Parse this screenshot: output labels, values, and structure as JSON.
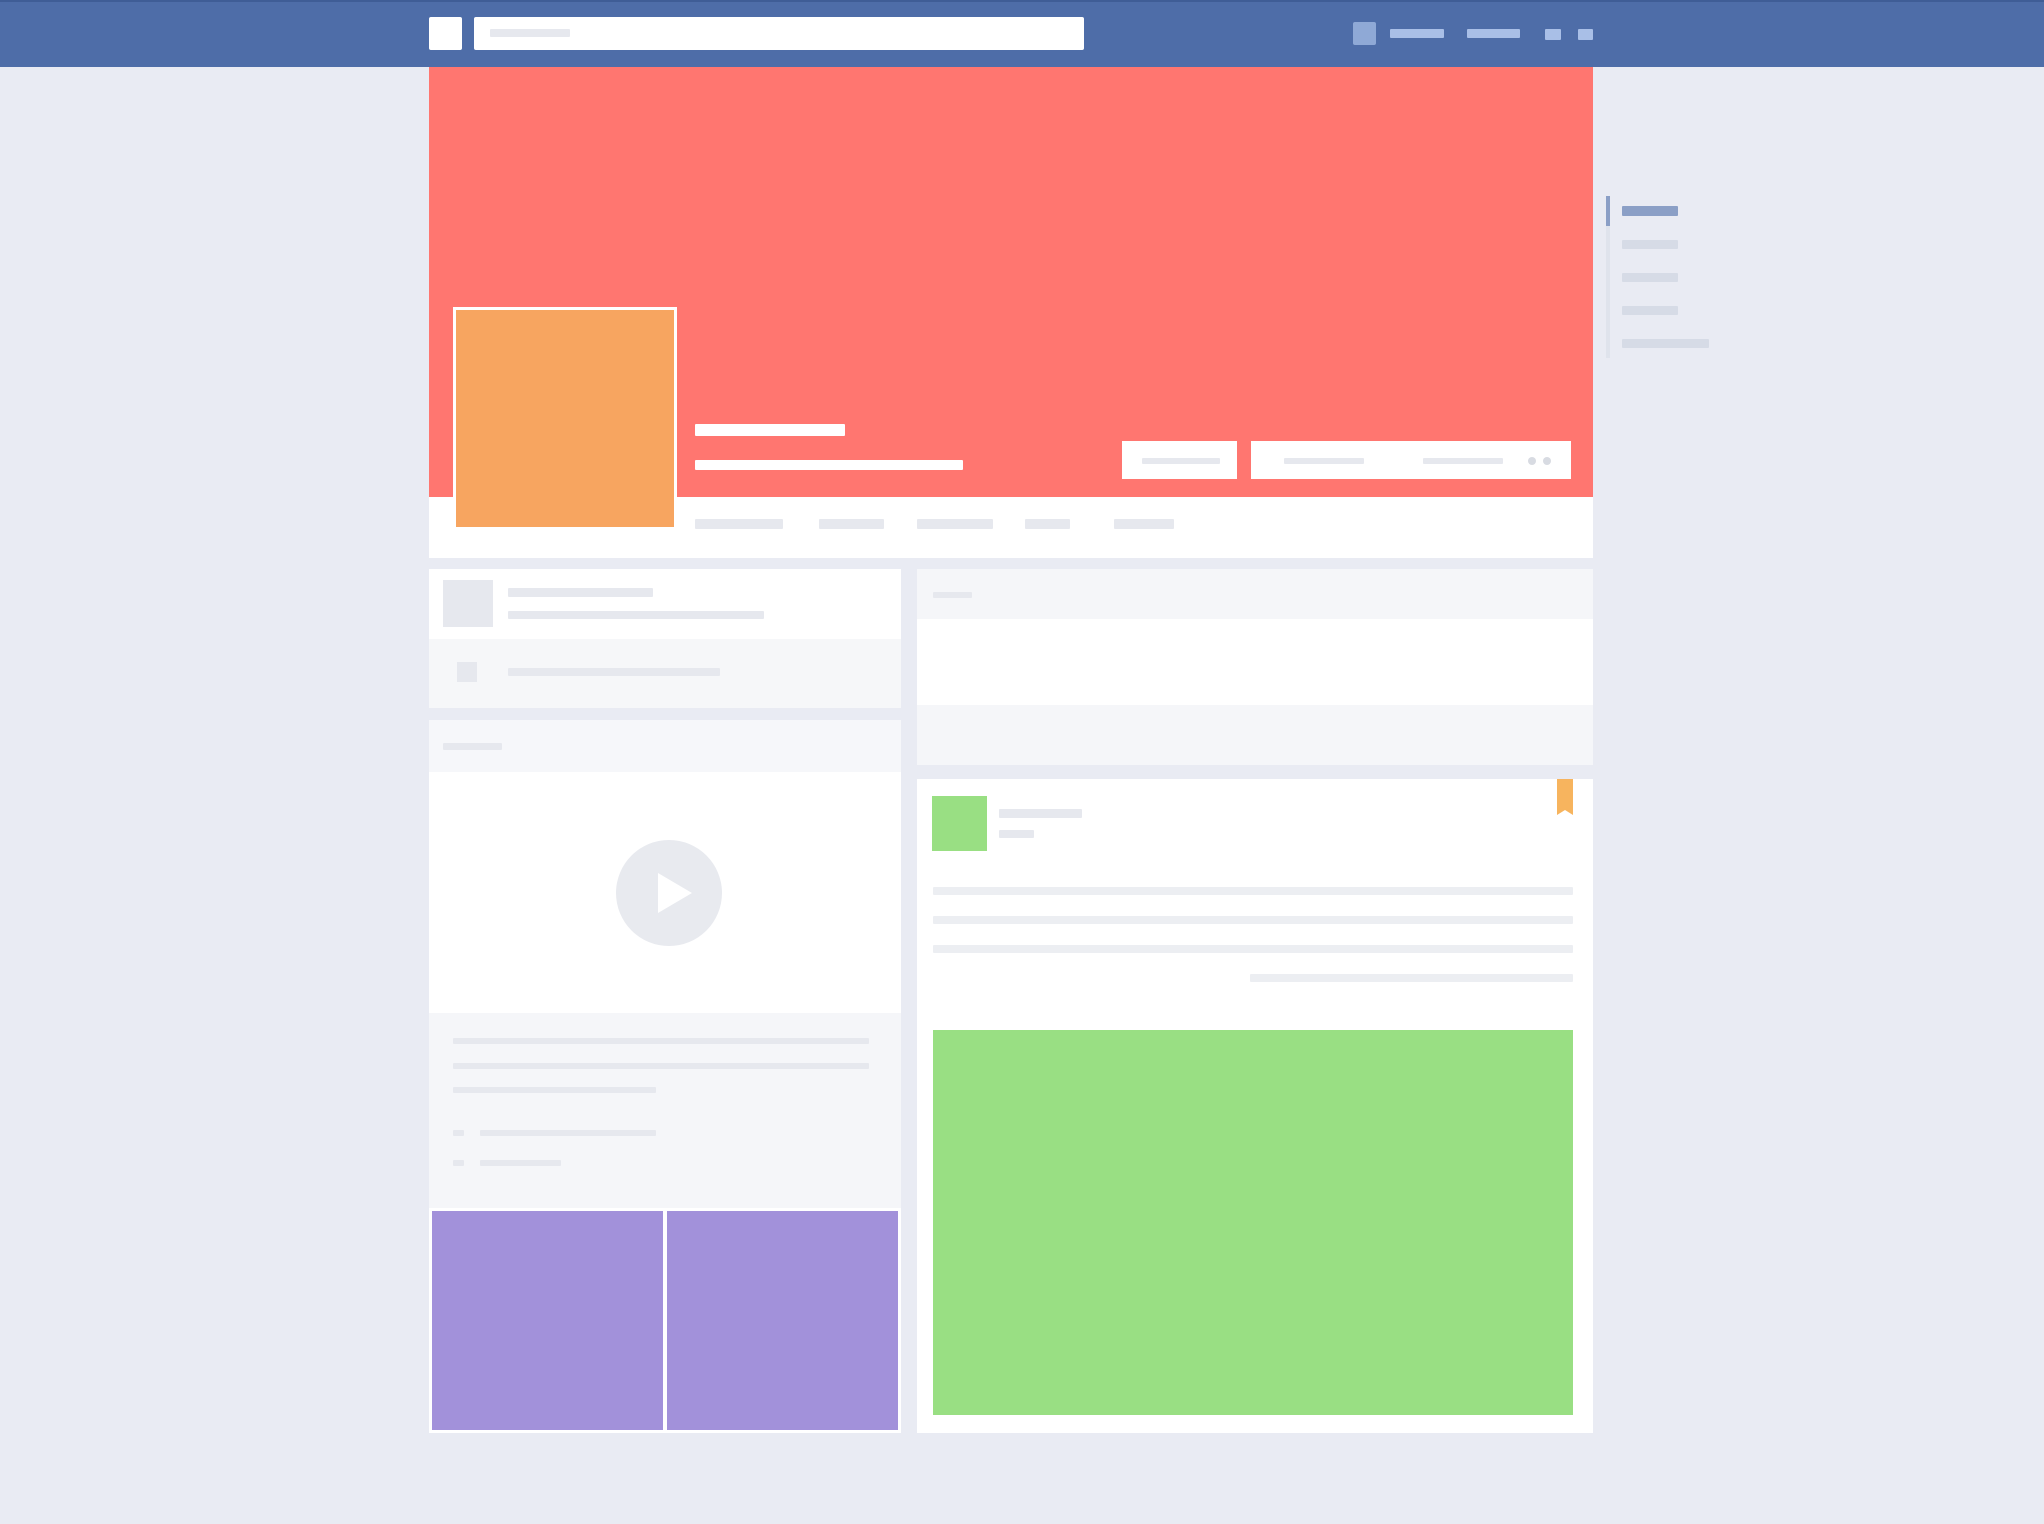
{
  "colors": {
    "nav": "#4e6da8",
    "cover": "#ff7670",
    "avatar": "#f7a560",
    "post_avatar": "#99df83",
    "post_image": "#99df83",
    "photo_tiles": "#a291da",
    "bookmark": "#f7b45e",
    "page_bg": "#e9ebf3"
  },
  "icons": {
    "logo": "logo-icon",
    "play": "play-icon",
    "bookmark": "bookmark-icon",
    "more": "more-dots-icon"
  }
}
